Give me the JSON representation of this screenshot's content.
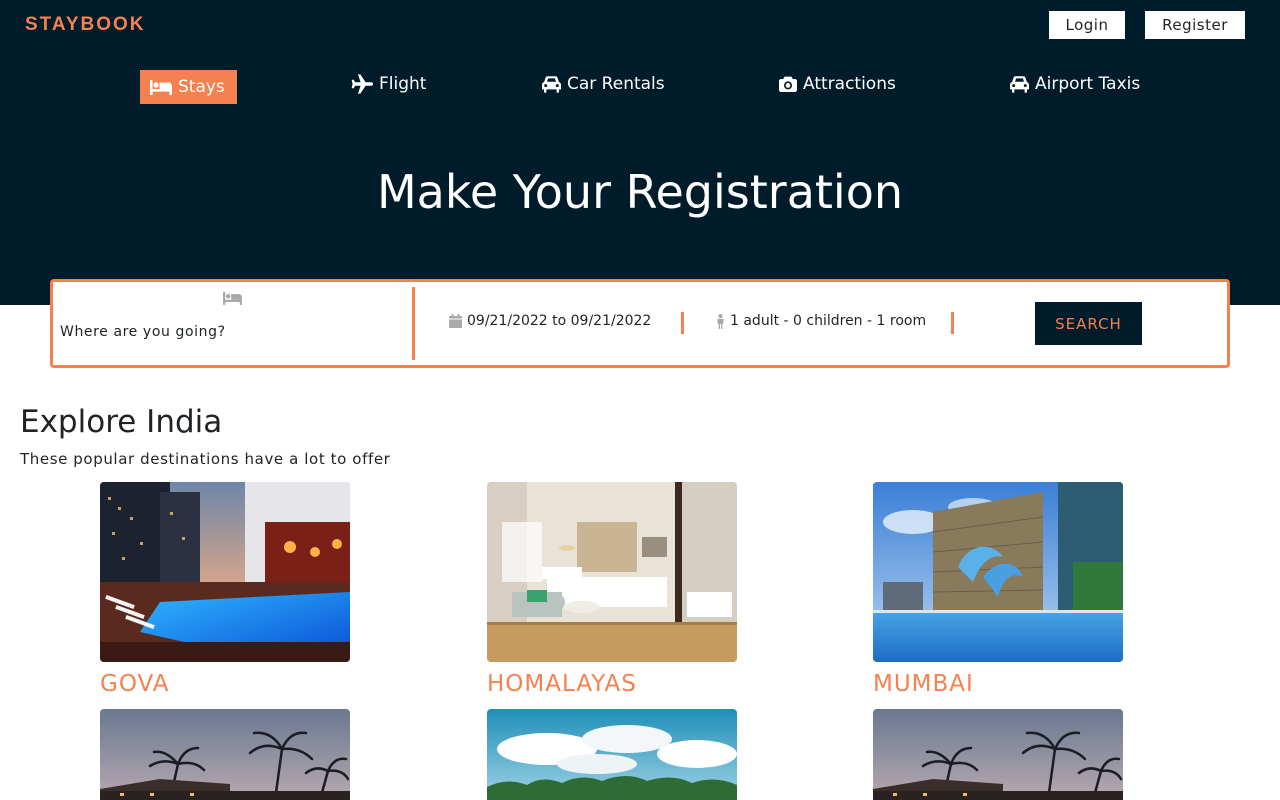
{
  "header": {
    "brand": "STAYBOOK",
    "login_label": "Login",
    "register_label": "Register"
  },
  "nav": {
    "stays": "Stays",
    "flight": "Flight",
    "car_rentals": "Car Rentals",
    "attractions": "Attractions",
    "airport_taxis": "Airport Taxis",
    "active": "Stays",
    "icons": [
      "bed-icon",
      "plane-icon",
      "car-icon",
      "camera-icon",
      "taxi-icon"
    ]
  },
  "hero": {
    "title": "Make Your Registration"
  },
  "search": {
    "destination_placeholder": "Where are you going?",
    "dates": "09/21/2022 to 09/21/2022",
    "guests": "1 adult - 0 children - 1 room",
    "button_label": "SEARCH"
  },
  "explore": {
    "title": "Explore India",
    "subtitle": "These popular destinations have a lot to offer",
    "destinations": [
      {
        "name": "GOVA",
        "image": "hotel-pool-night-photo"
      },
      {
        "name": "HOMALAYAS",
        "image": "hotel-room-photo"
      },
      {
        "name": "MUMBAI",
        "image": "dolphin-fountain-photo"
      },
      {
        "name": "",
        "image": "palm-resort-photo"
      },
      {
        "name": "",
        "image": "sky-trees-photo"
      },
      {
        "name": "",
        "image": "palm-resort-photo"
      }
    ]
  },
  "colors": {
    "navy": "#001b29",
    "accent": "#f4814f",
    "white": "#ffffff",
    "text": "#1f2326"
  }
}
